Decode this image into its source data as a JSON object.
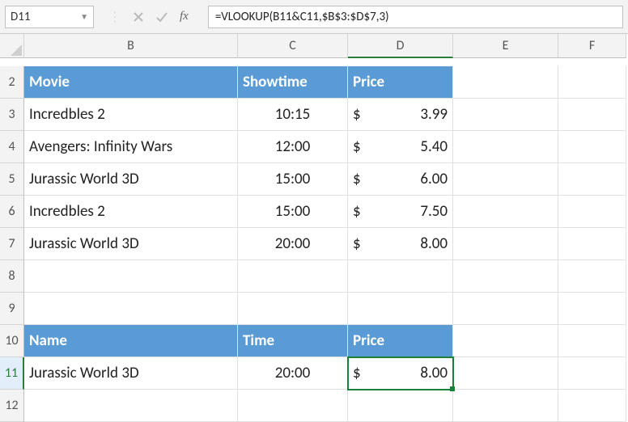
{
  "nameBox": "D11",
  "formula": "=VLOOKUP(B11&C11,$B$3:$D$7,3)",
  "fxLabel": "fx",
  "columns": [
    "B",
    "C",
    "D",
    "E",
    "F"
  ],
  "rows": [
    "2",
    "3",
    "4",
    "5",
    "6",
    "7",
    "8",
    "9",
    "10",
    "11",
    "12"
  ],
  "header1": {
    "movie": "Movie",
    "showtime": "Showtime",
    "price": "Price"
  },
  "data1": [
    {
      "movie": "Incredbles 2",
      "time": "10:15",
      "priceSym": "$",
      "priceVal": "3.99"
    },
    {
      "movie": "Avengers: Infinity Wars",
      "time": "12:00",
      "priceSym": "$",
      "priceVal": "5.40"
    },
    {
      "movie": "Jurassic World 3D",
      "time": "15:00",
      "priceSym": "$",
      "priceVal": "6.00"
    },
    {
      "movie": "Incredbles 2",
      "time": "15:00",
      "priceSym": "$",
      "priceVal": "7.50"
    },
    {
      "movie": "Jurassic World 3D",
      "time": "20:00",
      "priceSym": "$",
      "priceVal": "8.00"
    }
  ],
  "header2": {
    "name": "Name",
    "time": "Time",
    "price": "Price"
  },
  "lookup": {
    "name": "Jurassic World 3D",
    "time": "20:00",
    "priceSym": "$",
    "priceVal": "8.00"
  },
  "activeCell": "D11"
}
